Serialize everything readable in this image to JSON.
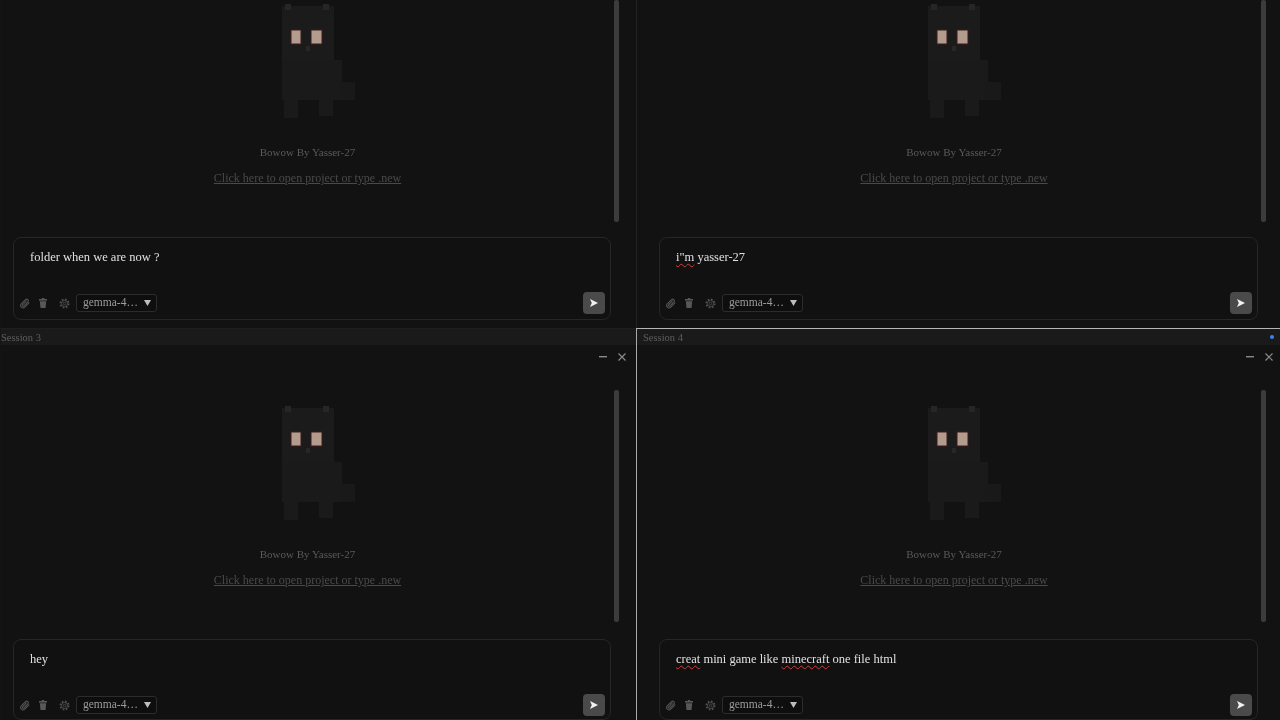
{
  "panes": [
    {
      "selected": false,
      "brand": "Bowow By Yasser-27",
      "link": "Click here to open project or type .new",
      "message": [
        {
          "text": "folder when we are now ?",
          "misspelled": false
        }
      ],
      "model": "gemma-4…"
    },
    {
      "selected": false,
      "brand": "Bowow By Yasser-27",
      "link": "Click here to open project or type .new",
      "message": [
        {
          "text": "i\"m",
          "misspelled": true
        },
        {
          "text": " yasser-27",
          "misspelled": false
        }
      ],
      "model": "gemma-4…"
    },
    {
      "title": "Session 3",
      "selected": false,
      "brand": "Bowow By Yasser-27",
      "link": "Click here to open project or type .new",
      "message": [
        {
          "text": "hey",
          "misspelled": false
        }
      ],
      "model": "gemma-4…"
    },
    {
      "title": "Session 4",
      "selected": true,
      "brand": "Bowow By Yasser-27",
      "link": "Click here to open project or type .new",
      "message": [
        {
          "text": "creat",
          "misspelled": true
        },
        {
          "text": " mini game like ",
          "misspelled": false
        },
        {
          "text": "minecraft",
          "misspelled": true
        },
        {
          "text": " one file html",
          "misspelled": false
        }
      ],
      "model": "gemma-4…"
    }
  ]
}
